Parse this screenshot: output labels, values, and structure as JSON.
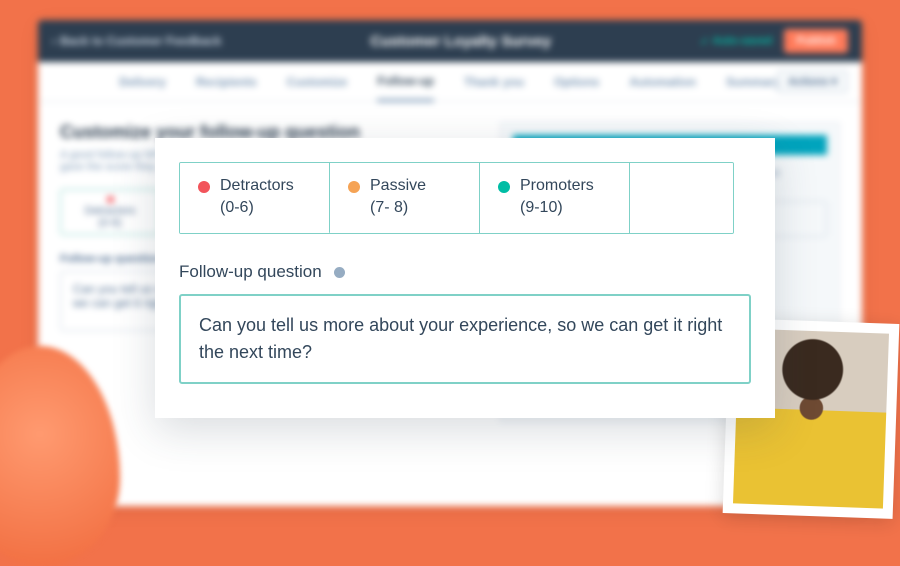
{
  "header": {
    "back_label": "Back to Customer Feedback",
    "title": "Customer Loyalty Survey",
    "autosaved_label": "Auto-saved",
    "publish_label": "Publish"
  },
  "tabs": {
    "items": [
      "Delivery",
      "Recipients",
      "Customize",
      "Follow-up",
      "Thank you",
      "Options",
      "Automation",
      "Summary"
    ],
    "active_index": 3,
    "actions_label": "Actions"
  },
  "page": {
    "heading": "Customize your follow-up question",
    "hint": "A good follow-up NPS question asks the customer why they gave the score they did.",
    "mini_tab": {
      "label": "Detractors",
      "range": "(0-6)"
    },
    "question_label": "Follow-up question",
    "question_text": "Can you tell us more about your experience, so we can get it right the next time?"
  },
  "card": {
    "segments": [
      {
        "label": "Detractors",
        "range": "(0-6)",
        "color": "red"
      },
      {
        "label": "Passive",
        "range": "(7- 8)",
        "color": "orange"
      },
      {
        "label": "Promoters",
        "range": "(9-10)",
        "color": "teal"
      }
    ],
    "active_segment_index": 0,
    "followup_label": "Follow-up question",
    "followup_value": "Can you tell us more about your experience, so we can get it right the next time?"
  }
}
